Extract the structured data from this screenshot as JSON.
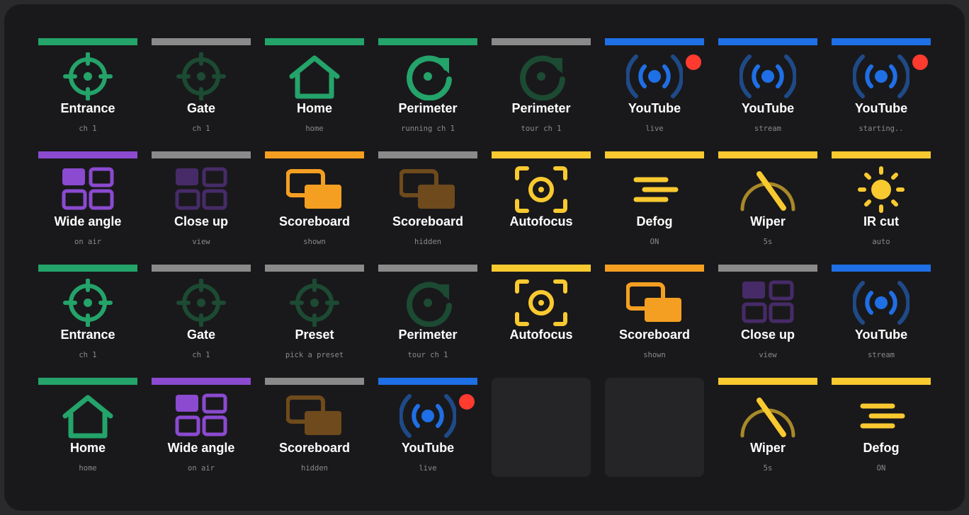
{
  "colors": {
    "green": "#24a36a",
    "green_dim": "#1c4a33",
    "gray": "#8a8a8a",
    "blue": "#1f6fe6",
    "blue_dim": "#1f4a88",
    "purple": "#8b4ad0",
    "purple_dim": "#472b68",
    "orange": "#f59f22",
    "orange_dim": "#6e4a1c",
    "yellow": "#f9c930",
    "yellow_dim": "#a88928",
    "live_dot": "#ff3b30",
    "empty_key": "#252527"
  },
  "deck": {
    "keys": [
      {
        "title": "Entrance",
        "status": "ch 1",
        "icon": "crosshair-icon",
        "bar": "green",
        "tone": "green",
        "live": false
      },
      {
        "title": "Gate",
        "status": "ch 1",
        "icon": "crosshair-icon",
        "bar": "gray",
        "tone": "green_dim",
        "live": false
      },
      {
        "title": "Home",
        "status": "home",
        "icon": "home-icon",
        "bar": "green",
        "tone": "green",
        "live": false
      },
      {
        "title": "Perimeter",
        "status": "running ch 1",
        "icon": "rotate-icon",
        "bar": "green",
        "tone": "green",
        "live": false
      },
      {
        "title": "Perimeter",
        "status": "tour ch 1",
        "icon": "rotate-icon",
        "bar": "gray",
        "tone": "green_dim",
        "live": false
      },
      {
        "title": "YouTube",
        "status": "live",
        "icon": "broadcast-icon",
        "bar": "blue",
        "tone": "blue",
        "live": true
      },
      {
        "title": "YouTube",
        "status": "stream",
        "icon": "broadcast-icon",
        "bar": "blue",
        "tone": "blue",
        "live": false
      },
      {
        "title": "YouTube",
        "status": "starting..",
        "icon": "broadcast-icon",
        "bar": "blue",
        "tone": "blue",
        "live": true
      },
      {
        "title": "Wide angle",
        "status": "on air",
        "icon": "grid-icon",
        "bar": "purple",
        "tone": "purple",
        "live": false
      },
      {
        "title": "Close up",
        "status": "view",
        "icon": "grid-icon",
        "bar": "gray",
        "tone": "purple_dim",
        "live": false
      },
      {
        "title": "Scoreboard",
        "status": "shown",
        "icon": "overlay-icon",
        "bar": "orange",
        "tone": "orange",
        "live": false
      },
      {
        "title": "Scoreboard",
        "status": "hidden",
        "icon": "overlay-icon",
        "bar": "gray",
        "tone": "orange_dim",
        "live": false
      },
      {
        "title": "Autofocus",
        "status": "",
        "icon": "autofocus-icon",
        "bar": "yellow",
        "tone": "yellow",
        "live": false
      },
      {
        "title": "Defog",
        "status": "ON",
        "icon": "defog-icon",
        "bar": "yellow",
        "tone": "yellow",
        "live": false
      },
      {
        "title": "Wiper",
        "status": "5s",
        "icon": "wiper-icon",
        "bar": "yellow",
        "tone": "yellow",
        "live": false
      },
      {
        "title": "IR cut",
        "status": "auto",
        "icon": "sun-icon",
        "bar": "yellow",
        "tone": "yellow",
        "live": false
      },
      {
        "title": "Entrance",
        "status": "ch 1",
        "icon": "crosshair-icon",
        "bar": "green",
        "tone": "green",
        "live": false
      },
      {
        "title": "Gate",
        "status": "ch 1",
        "icon": "crosshair-icon",
        "bar": "gray",
        "tone": "green_dim",
        "live": false
      },
      {
        "title": "Preset",
        "status": "pick a preset",
        "icon": "crosshair-icon",
        "bar": "gray",
        "tone": "green_dim",
        "live": false
      },
      {
        "title": "Perimeter",
        "status": "tour ch 1",
        "icon": "rotate-icon",
        "bar": "gray",
        "tone": "green_dim",
        "live": false
      },
      {
        "title": "Autofocus",
        "status": "",
        "icon": "autofocus-icon",
        "bar": "yellow",
        "tone": "yellow",
        "live": false
      },
      {
        "title": "Scoreboard",
        "status": "shown",
        "icon": "overlay-icon",
        "bar": "orange",
        "tone": "orange",
        "live": false
      },
      {
        "title": "Close up",
        "status": "view",
        "icon": "grid-icon",
        "bar": "gray",
        "tone": "purple_dim",
        "live": false
      },
      {
        "title": "YouTube",
        "status": "stream",
        "icon": "broadcast-icon",
        "bar": "blue",
        "tone": "blue",
        "live": false
      },
      {
        "title": "Home",
        "status": "home",
        "icon": "home-icon",
        "bar": "green",
        "tone": "green",
        "live": false
      },
      {
        "title": "Wide angle",
        "status": "on air",
        "icon": "grid-icon",
        "bar": "purple",
        "tone": "purple",
        "live": false
      },
      {
        "title": "Scoreboard",
        "status": "hidden",
        "icon": "overlay-icon",
        "bar": "gray",
        "tone": "orange_dim",
        "live": false
      },
      {
        "title": "YouTube",
        "status": "live",
        "icon": "broadcast-icon",
        "bar": "blue",
        "tone": "blue",
        "live": true
      },
      {
        "empty": true
      },
      {
        "empty": true
      },
      {
        "title": "Wiper",
        "status": "5s",
        "icon": "wiper-icon",
        "bar": "yellow",
        "tone": "yellow",
        "live": false
      },
      {
        "title": "Defog",
        "status": "ON",
        "icon": "defog-icon",
        "bar": "yellow",
        "tone": "yellow",
        "live": false
      }
    ]
  }
}
